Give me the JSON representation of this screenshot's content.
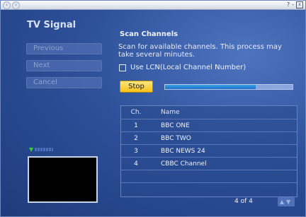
{
  "window": {
    "title": "TV Signal",
    "nav_back": "‹",
    "nav_forward": "›",
    "minimize": "-",
    "help": "?",
    "close": "x"
  },
  "sidebar": {
    "buttons": [
      "Previous",
      "Next",
      "Cancel"
    ]
  },
  "main": {
    "heading": "Scan Channels",
    "description": "Scan for available channels. This process may take several minutes.",
    "lcn_label": "Use LCN(Local Channel Number)",
    "lcn_checked": false,
    "stop_label": "Stop",
    "progress_fraction": 0.71
  },
  "channels": {
    "headers": [
      "Ch.",
      "Name"
    ],
    "rows": [
      {
        "ch": "1",
        "name": "BBC ONE"
      },
      {
        "ch": "2",
        "name": "BBC TWO"
      },
      {
        "ch": "3",
        "name": "BBC NEWS 24"
      },
      {
        "ch": "4",
        "name": "CBBC Channel"
      }
    ],
    "page_label": "4 of 4"
  },
  "icons": {
    "signal": "antenna-icon",
    "page_arrows": "up-down-arrows-icon"
  },
  "colors": {
    "accent": "#f5c218",
    "progress": "#1c6fc8",
    "background": "#2e519b"
  }
}
